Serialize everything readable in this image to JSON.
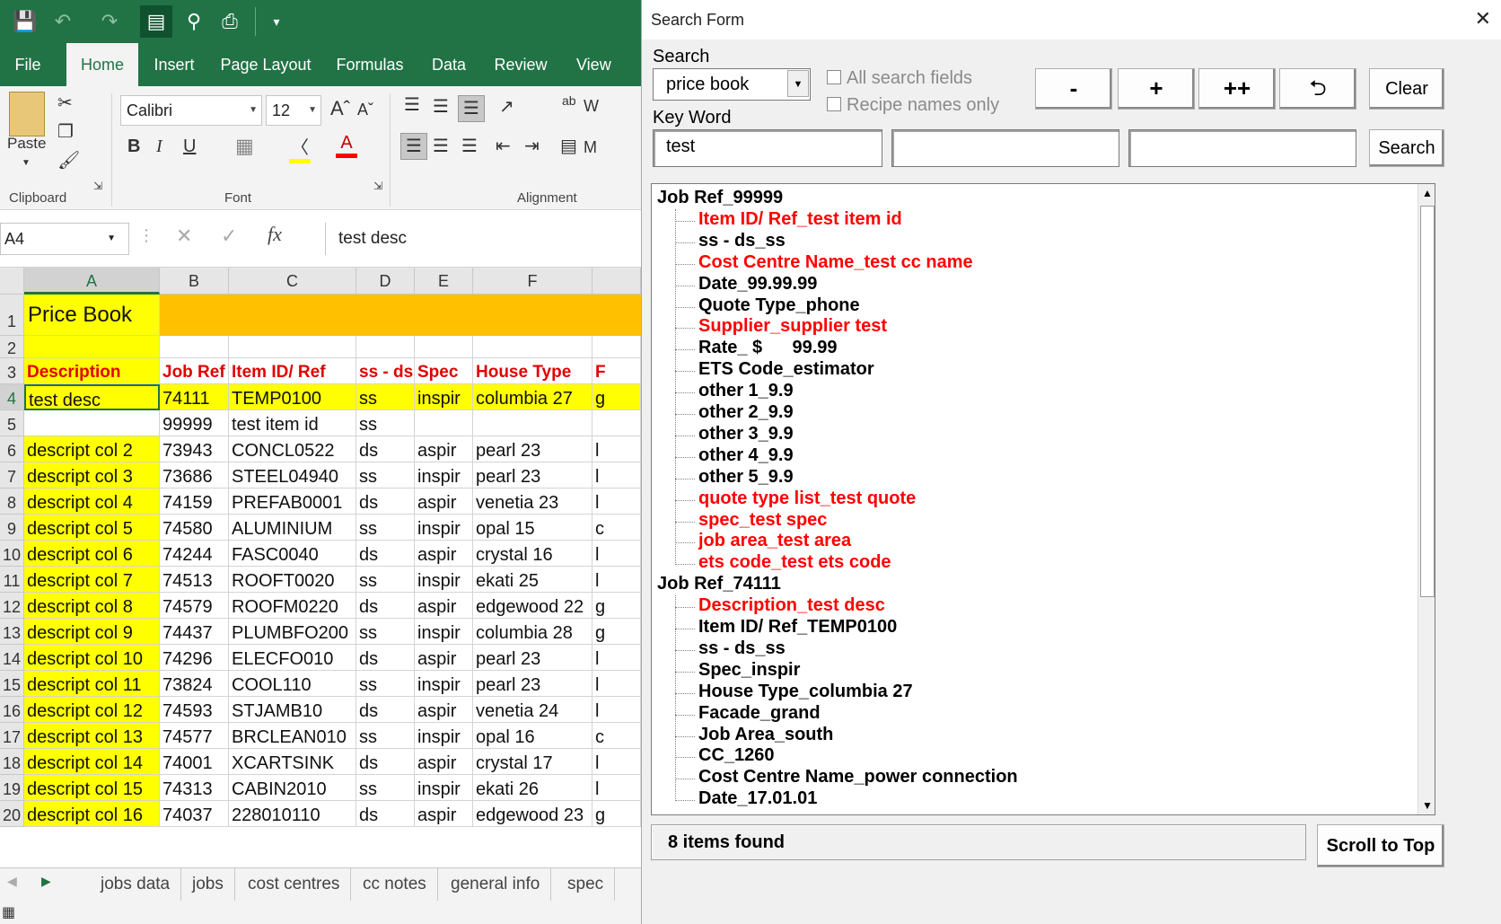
{
  "excel": {
    "tabs": [
      "File",
      "Home",
      "Insert",
      "Page Layout",
      "Formulas",
      "Data",
      "Review",
      "View"
    ],
    "ribbon": {
      "paste_label": "Paste",
      "clipboard_label": "Clipboard",
      "font_label": "Font",
      "alignment_label": "Alignment",
      "font_name": "Calibri",
      "font_size": "12",
      "wrap_label": "W",
      "merge_label": "M"
    },
    "name_box": "A4",
    "formula": "test desc",
    "columns": [
      "A",
      "B",
      "C",
      "D",
      "E",
      "F"
    ],
    "row_numbers": [
      "1",
      "2",
      "3",
      "4",
      "5",
      "6",
      "7",
      "8",
      "9",
      "10",
      "11",
      "12",
      "13",
      "14",
      "15",
      "16",
      "17",
      "18",
      "19",
      "20"
    ],
    "title": "Price Book",
    "headers": [
      "Description",
      "Job Ref",
      "Item ID/ Ref",
      "ss - ds",
      "Spec",
      "House Type",
      "F"
    ],
    "rows": [
      [
        "test desc",
        "74111",
        "TEMP0100",
        "ss",
        "inspir",
        "columbia 27",
        "g"
      ],
      [
        "",
        "99999",
        "test item id",
        "ss",
        "",
        "",
        ""
      ],
      [
        "descript col 2",
        "73943",
        "CONCL0522",
        "ds",
        "aspir",
        "pearl 23",
        "l"
      ],
      [
        "descript col 3",
        "73686",
        "STEEL04940",
        "ss",
        "inspir",
        "pearl 23",
        "l"
      ],
      [
        "descript col 4",
        "74159",
        "PREFAB0001",
        "ds",
        "aspir",
        "venetia 23",
        "l"
      ],
      [
        "descript col 5",
        "74580",
        "ALUMINIUM",
        "ss",
        "inspir",
        "opal 15",
        "c"
      ],
      [
        "descript col 6",
        "74244",
        "FASC0040",
        "ds",
        "aspir",
        "crystal 16",
        "l"
      ],
      [
        "descript col 7",
        "74513",
        "ROOFT0020",
        "ss",
        "inspir",
        "ekati 25",
        "l"
      ],
      [
        "descript col 8",
        "74579",
        "ROOFM0220",
        "ds",
        "aspir",
        "edgewood 22",
        "g"
      ],
      [
        "descript col 9",
        "74437",
        "PLUMBFO200",
        "ss",
        "inspir",
        "columbia 28",
        "g"
      ],
      [
        "descript col 10",
        "74296",
        "ELECFO010",
        "ds",
        "aspir",
        "pearl 23",
        "l"
      ],
      [
        "descript col 11",
        "73824",
        "COOL110",
        "ss",
        "inspir",
        "pearl 23",
        "l"
      ],
      [
        "descript col 12",
        "74593",
        "STJAMB10",
        "ds",
        "aspir",
        "venetia 24",
        "l"
      ],
      [
        "descript col 13",
        "74577",
        "BRCLEAN010",
        "ss",
        "inspir",
        "opal 16",
        "c"
      ],
      [
        "descript col 14",
        "74001",
        "XCARTSINK",
        "ds",
        "aspir",
        "crystal 17",
        "l"
      ],
      [
        "descript col 15",
        "74313",
        "CABIN2010",
        "ss",
        "inspir",
        "ekati 26",
        "l"
      ],
      [
        "descript col 16",
        "74037",
        "228010110",
        "ds",
        "aspir",
        "edgewood 23",
        "g"
      ]
    ],
    "sheet_tabs": [
      "jobs data",
      "jobs",
      "cost centres",
      "cc notes",
      "general info",
      "spec"
    ]
  },
  "form": {
    "title": "Search Form",
    "search_label": "Search",
    "search_value": "price book",
    "keyword_label": "Key Word",
    "keyword1": "test",
    "keyword2": "",
    "keyword3": "",
    "chk_all": "All search fields",
    "chk_recipe": "Recipe names only",
    "btn_minus": "-",
    "btn_plus": "+",
    "btn_plusplus": "++",
    "btn_undo": "⮌",
    "btn_clear": "Clear",
    "btn_search": "Search",
    "status": "8 items found",
    "btn_scroll": "Scroll to Top",
    "tree": [
      {
        "level": 0,
        "text": "Job Ref_99999",
        "red": false
      },
      {
        "level": 1,
        "text": "Item ID/ Ref_test item id",
        "red": true
      },
      {
        "level": 1,
        "text": "ss - ds_ss",
        "red": false
      },
      {
        "level": 1,
        "text": "Cost Centre Name_test cc name",
        "red": true
      },
      {
        "level": 1,
        "text": "Date_99.99.99",
        "red": false
      },
      {
        "level": 1,
        "text": "Quote Type_phone",
        "red": false
      },
      {
        "level": 1,
        "text": "Supplier_supplier test",
        "red": true
      },
      {
        "level": 1,
        "text": "Rate_ $      99.99",
        "red": false
      },
      {
        "level": 1,
        "text": "ETS Code_estimator",
        "red": false
      },
      {
        "level": 1,
        "text": "other 1_9.9",
        "red": false
      },
      {
        "level": 1,
        "text": "other 2_9.9",
        "red": false
      },
      {
        "level": 1,
        "text": "other 3_9.9",
        "red": false
      },
      {
        "level": 1,
        "text": "other 4_9.9",
        "red": false
      },
      {
        "level": 1,
        "text": "other 5_9.9",
        "red": false
      },
      {
        "level": 1,
        "text": "quote type list_test quote",
        "red": true
      },
      {
        "level": 1,
        "text": "spec_test spec",
        "red": true
      },
      {
        "level": 1,
        "text": "job area_test area",
        "red": true
      },
      {
        "level": 1,
        "text": "ets code_test ets code",
        "red": true
      },
      {
        "level": 0,
        "text": "Job Ref_74111",
        "red": false
      },
      {
        "level": 1,
        "text": "Description_test desc",
        "red": true
      },
      {
        "level": 1,
        "text": "Item ID/ Ref_TEMP0100",
        "red": false
      },
      {
        "level": 1,
        "text": "ss - ds_ss",
        "red": false
      },
      {
        "level": 1,
        "text": "Spec_inspir",
        "red": false
      },
      {
        "level": 1,
        "text": "House Type_columbia 27",
        "red": false
      },
      {
        "level": 1,
        "text": "Facade_grand",
        "red": false
      },
      {
        "level": 1,
        "text": "Job Area_south",
        "red": false
      },
      {
        "level": 1,
        "text": "CC_1260",
        "red": false
      },
      {
        "level": 1,
        "text": "Cost Centre Name_power connection",
        "red": false
      },
      {
        "level": 1,
        "text": "Date_17.01.01",
        "red": false
      }
    ]
  },
  "colors": {
    "excel_green": "#217346",
    "yellow": "#ffff00",
    "orange": "#ffc000",
    "header_red": "#e00000",
    "tree_red": "#ff0000"
  }
}
